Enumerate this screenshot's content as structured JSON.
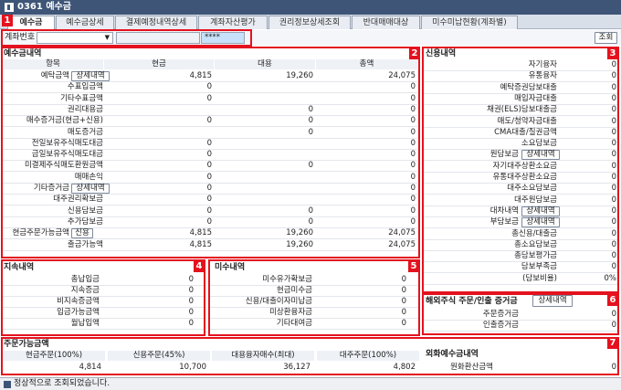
{
  "window": {
    "title": "0361 예수금"
  },
  "tabs": [
    "예수금",
    "예수금상세",
    "결제예정내역상세",
    "계좌자산평가",
    "권리정보상세조회",
    "반대매매대상",
    "미수미납현황(계좌별)"
  ],
  "account": {
    "label": "계좌번호",
    "password": "****",
    "search_button": "조회"
  },
  "badges": [
    "1",
    "2",
    "3",
    "4",
    "5",
    "6",
    "7"
  ],
  "deposit": {
    "title": "예수금내역",
    "cols": [
      "항목",
      "현금",
      "대용",
      "총액"
    ],
    "detail_button": "상세내역",
    "credit_button": "신용",
    "rows": [
      {
        "label": "예탁금액",
        "cash": "4,815",
        "sub": "19,260",
        "total": "24,075",
        "btn": "detail"
      },
      {
        "label": "수표입금액",
        "cash": "0",
        "sub": "",
        "total": "0"
      },
      {
        "label": "기타수표금액",
        "cash": "0",
        "sub": "",
        "total": "0"
      },
      {
        "label": "권리대용금",
        "cash": "",
        "sub": "0",
        "total": "0"
      },
      {
        "label": "매수증거금(현금+신용)",
        "cash": "0",
        "sub": "0",
        "total": "0"
      },
      {
        "label": "매도증거금",
        "cash": "",
        "sub": "0",
        "total": "0"
      },
      {
        "label": "전일보유주식매도대금",
        "cash": "0",
        "sub": "",
        "total": "0"
      },
      {
        "label": "금일보유주식매도대금",
        "cash": "0",
        "sub": "",
        "total": "0"
      },
      {
        "label": "미결제주식매도환원금액",
        "cash": "0",
        "sub": "0",
        "total": "0"
      },
      {
        "label": "매매손익",
        "cash": "0",
        "sub": "",
        "total": "0"
      },
      {
        "label": "기타증거금",
        "cash": "0",
        "sub": "",
        "total": "0",
        "btn": "detail"
      },
      {
        "label": "대주권리확보금",
        "cash": "0",
        "sub": "",
        "total": "0"
      },
      {
        "label": "신용담보금",
        "cash": "0",
        "sub": "0",
        "total": "0"
      },
      {
        "label": "추가담보금",
        "cash": "0",
        "sub": "0",
        "total": "0"
      },
      {
        "label": "현금주문가능금액",
        "cash": "4,815",
        "sub": "19,260",
        "total": "24,075",
        "btn": "credit"
      },
      {
        "label": "출금가능액",
        "cash": "4,815",
        "sub": "19,260",
        "total": "24,075"
      }
    ]
  },
  "credit": {
    "title": "신용내역",
    "rows": [
      {
        "label": "자기융자",
        "value": "0"
      },
      {
        "label": "유통융자",
        "value": "0"
      },
      {
        "label": "예탁증권담보대출",
        "value": "0"
      },
      {
        "label": "매입자금대출",
        "value": "0"
      },
      {
        "label": "채권(ELS)담보대출금",
        "value": "0"
      },
      {
        "label": "매도/청약자금대출",
        "value": "0"
      },
      {
        "label": "CMA대출/질권금액",
        "value": "0"
      },
      {
        "label": "소요담보금",
        "value": "0"
      },
      {
        "label": "원담보금",
        "value": "0",
        "btn": true
      },
      {
        "label": "자기대주상환소요금",
        "value": "0"
      },
      {
        "label": "유통대주상환소요금",
        "value": "0"
      },
      {
        "label": "대주소요담보금",
        "value": "0"
      },
      {
        "label": "대주원담보금",
        "value": "0"
      },
      {
        "label": "대차내역",
        "value": "0",
        "btn": true
      },
      {
        "label": "부담보금",
        "value": "0",
        "btn": true
      },
      {
        "label": "총신용/대출금",
        "value": "0"
      },
      {
        "label": "총소요담보금",
        "value": "0"
      },
      {
        "label": "총담보평가금",
        "value": "0"
      },
      {
        "label": "담보부족금",
        "value": "0"
      },
      {
        "label": "(담보비율)",
        "value": "0%"
      }
    ]
  },
  "arrears": {
    "title": "지속내역",
    "rows": [
      {
        "label": "총납입금",
        "value": "0"
      },
      {
        "label": "지속증금",
        "value": "0"
      },
      {
        "label": "비지속증금액",
        "value": "0"
      },
      {
        "label": "입금가능금액",
        "value": "0"
      },
      {
        "label": "월납입액",
        "value": "0"
      }
    ]
  },
  "unpaid": {
    "title": "미수내역",
    "rows": [
      {
        "label": "미수유가확보금",
        "value": "0"
      },
      {
        "label": "현금미수금",
        "value": "0"
      },
      {
        "label": "신용/대출이자미납금",
        "value": "0"
      },
      {
        "label": "미상환융자금",
        "value": "0"
      },
      {
        "label": "기타대여금",
        "value": "0"
      }
    ]
  },
  "overseas": {
    "title": "해외주식 주문/인출 증거금",
    "button": "상세내역",
    "rows": [
      {
        "label": "주문증거금",
        "value": "0"
      },
      {
        "label": "인출증거금",
        "value": "0"
      }
    ]
  },
  "orderable": {
    "title": "주문가능금액",
    "cols": [
      "현금주문(100%)",
      "신용주문(45%)",
      "대용융자매수(최대)",
      "대주주문(100%)"
    ],
    "values": [
      "4,814",
      "10,700",
      "36,127",
      "4,802"
    ]
  },
  "fx": {
    "title": "외화예수금내역",
    "rows": [
      {
        "label": "원화환산금액",
        "value": "0"
      }
    ]
  },
  "status": {
    "message": "정상적으로 조회되었습니다."
  },
  "colors": {
    "accent_red": "#e4121e",
    "title_bar": "#3e5577",
    "button_blue": "#9cc0f0"
  }
}
